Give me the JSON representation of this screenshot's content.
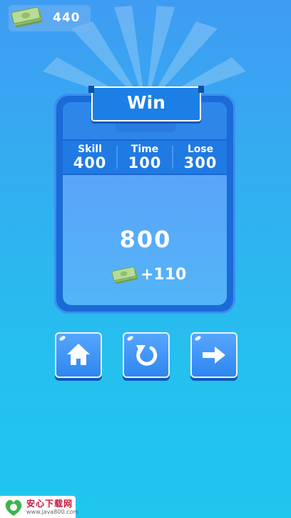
{
  "currency": {
    "icon": "cash-bill-icon",
    "value": "440"
  },
  "panel": {
    "title": "Win",
    "stats": [
      {
        "label": "Skill",
        "value": "400"
      },
      {
        "label": "Time",
        "value": "100"
      },
      {
        "label": "Lose",
        "value": "300"
      }
    ],
    "score": "800",
    "reward": {
      "icon": "cash-bill-icon",
      "value": "+110"
    }
  },
  "buttons": {
    "home_icon": "home-icon",
    "restart_icon": "restart-icon",
    "next_icon": "arrow-right-icon"
  },
  "watermark": {
    "title": "安心下载网",
    "url": "www.java800.com"
  },
  "colors": {
    "panel_border": "#1a6ad8",
    "panel_fill": "#5aa5f9",
    "button_fill": "#2f86f0",
    "bill_green": "#9cc97a"
  }
}
